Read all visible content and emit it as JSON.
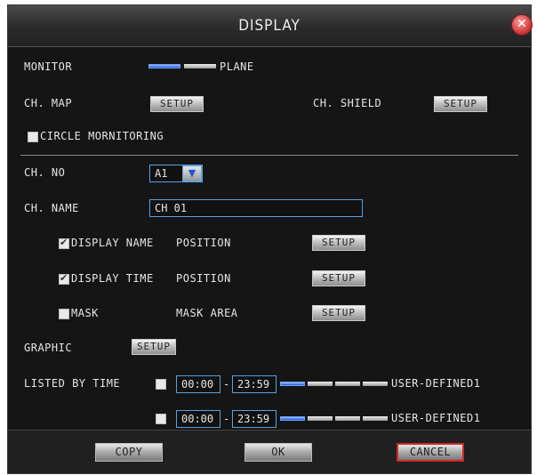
{
  "dialog": {
    "title": "DISPLAY",
    "close_icon": "close-icon"
  },
  "monitor": {
    "label": "MONITOR",
    "mode": "PLANE",
    "segments": [
      true,
      false
    ]
  },
  "ch_map": {
    "label": "CH. MAP",
    "button": "SETUP"
  },
  "ch_shield": {
    "label": "CH. SHIELD",
    "button": "SETUP"
  },
  "circle": {
    "label": "CIRCLE MORNITORING",
    "checked": false
  },
  "ch_no": {
    "label": "CH. NO",
    "value": "A1"
  },
  "ch_name": {
    "label": "CH. NAME",
    "value": "CH 01"
  },
  "display_name": {
    "label": "DISPLAY NAME",
    "checked": true,
    "sub": "POSITION",
    "button": "SETUP"
  },
  "display_time": {
    "label": "DISPLAY TIME",
    "checked": true,
    "sub": "POSITION",
    "button": "SETUP"
  },
  "mask": {
    "label": "MASK",
    "checked": false,
    "sub": "MASK AREA",
    "button": "SETUP"
  },
  "graphic": {
    "label": "GRAPHIC",
    "button": "SETUP"
  },
  "listed": {
    "label": "LISTED BY TIME",
    "rows": [
      {
        "start": "00:00",
        "sep": "-",
        "end": "23:59",
        "mode": "USER-DEFINED1",
        "segments": [
          true,
          false,
          false,
          false
        ]
      },
      {
        "start": "00:00",
        "sep": "-",
        "end": "23:59",
        "mode": "USER-DEFINED1",
        "segments": [
          true,
          false,
          false,
          false
        ]
      }
    ]
  },
  "footer": {
    "copy": "COPY",
    "ok": "OK",
    "cancel": "CANCEL"
  },
  "colors": {
    "accent": "#1c57d8",
    "cancel_border": "#d52525",
    "background": "#151515"
  }
}
